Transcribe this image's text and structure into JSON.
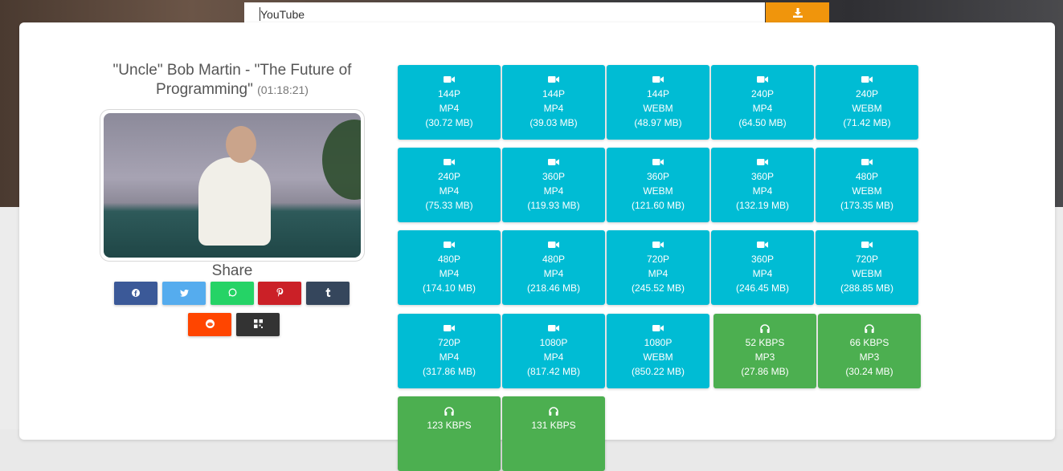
{
  "search": {
    "value": "YouTube"
  },
  "video": {
    "title": "\"Uncle\" Bob Martin - \"The Future of Programming\"",
    "duration": "(01:18:21)"
  },
  "share": {
    "label": "Share",
    "buttons": [
      {
        "name": "facebook",
        "icon": "facebook-icon",
        "color": "#3b5998"
      },
      {
        "name": "twitter",
        "icon": "twitter-icon",
        "color": "#55acee"
      },
      {
        "name": "whatsapp",
        "icon": "whatsapp-icon",
        "color": "#25d366"
      },
      {
        "name": "pinterest",
        "icon": "pinterest-icon",
        "color": "#cb2027"
      },
      {
        "name": "tumblr",
        "icon": "tumblr-icon",
        "color": "#35465c"
      },
      {
        "name": "reddit",
        "icon": "reddit-icon",
        "color": "#ff4500"
      },
      {
        "name": "qr",
        "icon": "qr-code-icon",
        "color": "#333333"
      }
    ]
  },
  "formats": [
    {
      "kind": "video",
      "quality": "144P",
      "format": "MP4",
      "size": "(30.72 MB)"
    },
    {
      "kind": "video",
      "quality": "144P",
      "format": "MP4",
      "size": "(39.03 MB)"
    },
    {
      "kind": "video",
      "quality": "144P",
      "format": "WEBM",
      "size": "(48.97 MB)"
    },
    {
      "kind": "video",
      "quality": "240P",
      "format": "MP4",
      "size": "(64.50 MB)"
    },
    {
      "kind": "video",
      "quality": "240P",
      "format": "WEBM",
      "size": "(71.42 MB)"
    },
    {
      "kind": "video",
      "quality": "240P",
      "format": "MP4",
      "size": "(75.33 MB)"
    },
    {
      "kind": "video",
      "quality": "360P",
      "format": "MP4",
      "size": "(119.93 MB)"
    },
    {
      "kind": "video",
      "quality": "360P",
      "format": "WEBM",
      "size": "(121.60 MB)"
    },
    {
      "kind": "video",
      "quality": "360P",
      "format": "MP4",
      "size": "(132.19 MB)"
    },
    {
      "kind": "video",
      "quality": "480P",
      "format": "WEBM",
      "size": "(173.35 MB)"
    },
    {
      "kind": "video",
      "quality": "480P",
      "format": "MP4",
      "size": "(174.10 MB)"
    },
    {
      "kind": "video",
      "quality": "480P",
      "format": "MP4",
      "size": "(218.46 MB)"
    },
    {
      "kind": "video",
      "quality": "720P",
      "format": "MP4",
      "size": "(245.52 MB)"
    },
    {
      "kind": "video",
      "quality": "360P",
      "format": "MP4",
      "size": "(246.45 MB)"
    },
    {
      "kind": "video",
      "quality": "720P",
      "format": "WEBM",
      "size": "(288.85 MB)"
    },
    {
      "kind": "video",
      "quality": "720P",
      "format": "MP4",
      "size": "(317.86 MB)"
    },
    {
      "kind": "video",
      "quality": "1080P",
      "format": "MP4",
      "size": "(817.42 MB)"
    },
    {
      "kind": "video",
      "quality": "1080P",
      "format": "WEBM",
      "size": "(850.22 MB)"
    },
    {
      "kind": "audio",
      "quality": "52 KBPS",
      "format": "MP3",
      "size": "(27.86 MB)"
    },
    {
      "kind": "audio",
      "quality": "66 KBPS",
      "format": "MP3",
      "size": "(30.24 MB)"
    },
    {
      "kind": "audio",
      "quality": "123 KBPS",
      "format": "",
      "size": ""
    },
    {
      "kind": "audio",
      "quality": "131 KBPS",
      "format": "",
      "size": ""
    }
  ],
  "colors": {
    "video_tile": "#00bcd4",
    "audio_tile": "#4caf50",
    "download": "#f0950c"
  }
}
